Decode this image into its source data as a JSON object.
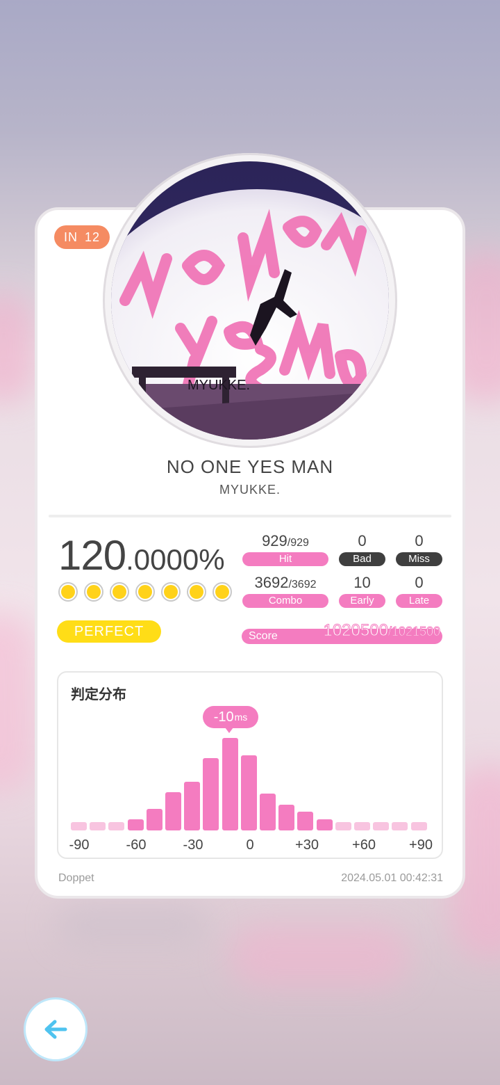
{
  "level": {
    "difficulty": "IN",
    "value": "12"
  },
  "song": {
    "title": "NO ONE YES MAN",
    "artist": "MYUKKE."
  },
  "jacket": {
    "logo_text": "MYUKKE."
  },
  "accuracy": {
    "whole": "120",
    "fraction": ".0000%"
  },
  "rating_dots": 7,
  "rank_badge": "PERFECT",
  "stats": {
    "hit": {
      "value": "929",
      "total": "/929",
      "label": "Hit"
    },
    "bad": {
      "value": "0",
      "label": "Bad"
    },
    "miss": {
      "value": "0",
      "label": "Miss"
    },
    "combo": {
      "value": "3692",
      "total": "/3692",
      "label": "Combo"
    },
    "early": {
      "value": "10",
      "label": "Early"
    },
    "late": {
      "value": "0",
      "label": "Late"
    },
    "score": {
      "label": "Score",
      "value": "1020500",
      "total": "/1021500"
    }
  },
  "distribution": {
    "title": "判定分布",
    "offset_value": "-10",
    "offset_unit": "ms",
    "tick_labels": [
      "-90",
      "-60",
      "-30",
      "0",
      "+30",
      "+60",
      "+90"
    ]
  },
  "chart_data": {
    "type": "bar",
    "xlabel": "",
    "ylabel": "",
    "x": [
      -90,
      -80,
      -70,
      -60,
      -50,
      -40,
      -30,
      -20,
      -10,
      0,
      10,
      20,
      30,
      40,
      50,
      60,
      70,
      80,
      90
    ],
    "values": [
      0.09,
      0.09,
      0.09,
      0.12,
      0.23,
      0.41,
      0.53,
      0.78,
      1.0,
      0.81,
      0.4,
      0.28,
      0.2,
      0.12,
      0.09,
      0.09,
      0.09,
      0.09,
      0.09
    ],
    "colors": {
      "primary": "#f47cc0",
      "faint": "#f8c4e0"
    }
  },
  "footer": {
    "app_name": "Doppet",
    "timestamp": "2024.05.01 00:42:31"
  },
  "colors": {
    "accent_pink": "#f47cc0",
    "level_badge": "#f58b62",
    "perfect_yellow": "#ffdd17",
    "dark_label": "#3f3f3f"
  },
  "back_button": {
    "icon": "arrow-left-icon"
  }
}
